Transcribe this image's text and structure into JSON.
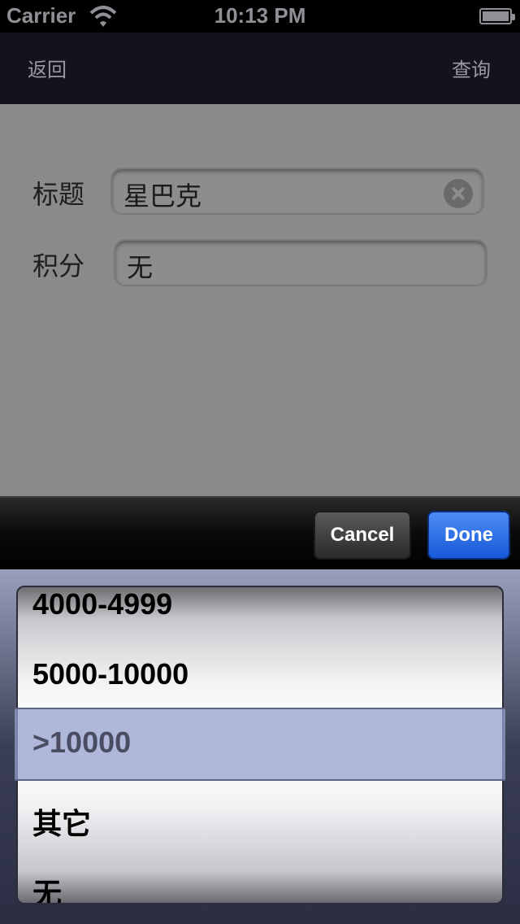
{
  "status_bar": {
    "carrier": "Carrier",
    "time": "10:13 PM"
  },
  "nav_bar": {
    "back_label": "返回",
    "query_label": "查询"
  },
  "form": {
    "title_label": "标题",
    "title_value": "星巴克",
    "points_label": "积分",
    "points_value": "无"
  },
  "toolbar": {
    "cancel_label": "Cancel",
    "done_label": "Done"
  },
  "picker": {
    "rows": [
      "4000-4999",
      "5000-10000",
      ">10000",
      "其它",
      "无"
    ],
    "selected": ">10000"
  }
}
